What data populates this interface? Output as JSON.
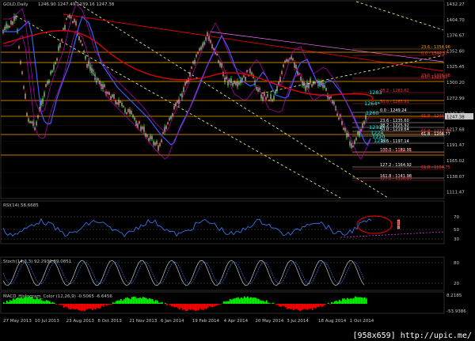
{
  "header": {
    "title": "GOLD,Daily",
    "ohlc": "1246.90 1247.49 1239.16 1247.38"
  },
  "colors": {
    "background": "#000000",
    "grid": "#1b2a1b",
    "bull": "#00ff00",
    "bear": "#ff0000",
    "candle_body": "#c8c8c8",
    "ma_blue": "#3a5fff",
    "ma_red": "#e00000",
    "envelope": "#c000c0",
    "fib": "#ff9900",
    "level_line": "#ffa500",
    "channel": "#ffff99",
    "cyan": "#00ffff",
    "white": "#ffffff"
  },
  "price_axis": [
    "1432.27",
    "1404.70",
    "1376.67",
    "1352.60",
    "1325.45",
    "1300.20",
    "1272.99",
    "1247.38",
    "1217.68",
    "1191.47",
    "1165.02",
    "1138.07",
    "1111.47"
  ],
  "current_price": "1247.38",
  "levels_wave": [
    {
      "label": "1283",
      "color": "#00ffff"
    },
    {
      "label": "1264*",
      "color": "#00ffff"
    },
    {
      "label": "1260",
      "color": "#00ffff"
    },
    {
      "label": "1233*",
      "color": "#00ffff"
    },
    {
      "label": "1224",
      "color": "#00ffff"
    },
    {
      "label": "1220",
      "color": "#00ffff"
    },
    {
      "label": "1217",
      "color": "#00ffff"
    }
  ],
  "fib_labels": [
    {
      "text": "23.6 - 1354.96",
      "color": "#ff9900"
    },
    {
      "text": "0.0 - 1344.87",
      "color": "#ff3333"
    },
    {
      "text": "23.6 - 1326.08",
      "color": "#ff3333"
    },
    {
      "text": "0.0 - 1321.62",
      "color": "#ff3333"
    },
    {
      "text": "38.2 - 1283.62",
      "color": "#ff3333"
    },
    {
      "text": "50.0 - 1263.91",
      "color": "#ff3333"
    },
    {
      "text": "0.0 - 1249.24",
      "color": "#ffffff"
    },
    {
      "text": "61.8 - 1244.88",
      "color": "#ff3333"
    },
    {
      "text": "23.6 - 1235.60",
      "color": "#ffffff"
    },
    {
      "text": "38.2 - 1225.92",
      "color": "#ffffff"
    },
    {
      "text": "50.0 - 1219.64",
      "color": "#ffffff"
    },
    {
      "text": "61.8 - 1217.60",
      "color": "#ff3333"
    },
    {
      "text": "61.8 - 1208.77",
      "color": "#ffffff"
    },
    {
      "text": "78.6 - 1197.14",
      "color": "#ffffff"
    },
    {
      "text": "100.0 - 1182.95",
      "color": "#ffffff"
    },
    {
      "text": "100.0 - 1180.79",
      "color": "#ff3333"
    },
    {
      "text": "127.2 - 1164.92",
      "color": "#ffffff"
    },
    {
      "text": "61.8 - 1154.75",
      "color": "#ff3333"
    },
    {
      "text": "161.8 - 1141.98",
      "color": "#ffffff"
    },
    {
      "text": "127.2 - 1138.93",
      "color": "#ff3333"
    }
  ],
  "rsi": {
    "label": "RSI(14) 58.6685",
    "axis": [
      "70",
      "50",
      "30"
    ]
  },
  "stoch": {
    "label": "Stoch(14,3,3) 92.2930 89.0851",
    "axis": [
      "80",
      "20"
    ]
  },
  "macd": {
    "label": "MACD_Histogram_Color (12,26,9) -0.5065 -6.6456",
    "axis": [
      "8.2185",
      "-53.9386"
    ]
  },
  "date_axis": [
    "27 May 2013",
    "10 Jul 2013",
    "23 Aug 2013",
    "8 Oct 2013",
    "21 Nov 2013",
    "6 Jan 2014",
    "19 Feb 2014",
    "4 Apr 2014",
    "20 May 2014",
    "3 Jul 2014",
    "18 Aug 2014",
    "1 Oct 2014"
  ],
  "annotation_mark": "!",
  "footer": "[958x659] http://upic.me/"
}
